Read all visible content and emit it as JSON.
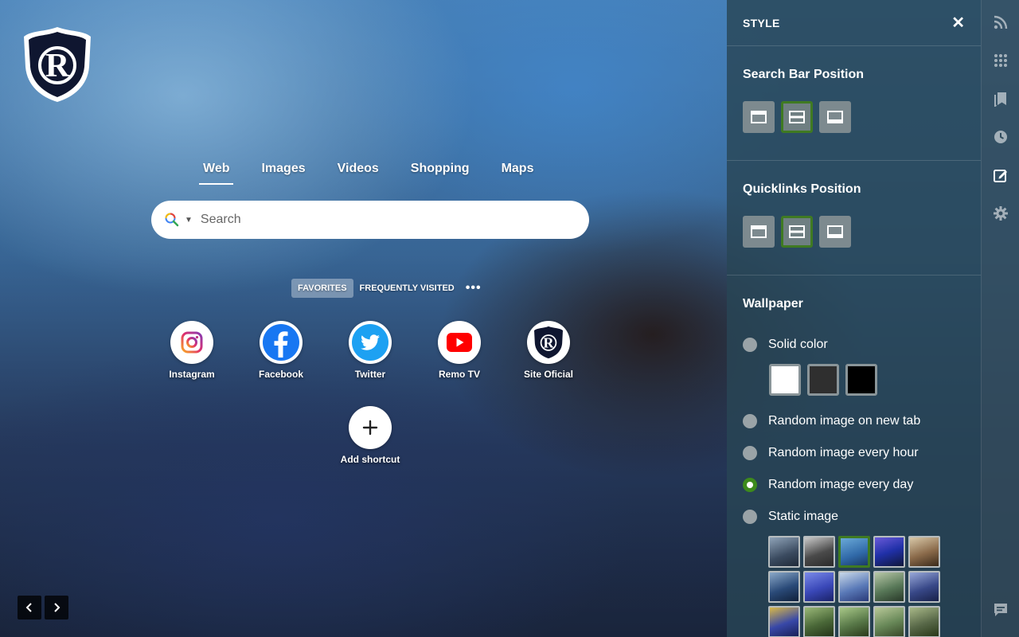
{
  "search": {
    "tabs": [
      {
        "label": "Web"
      },
      {
        "label": "Images"
      },
      {
        "label": "Videos"
      },
      {
        "label": "Shopping"
      },
      {
        "label": "Maps"
      }
    ],
    "placeholder": "Search"
  },
  "quicklinks": {
    "favorites_label": "FAVORITES",
    "frequent_label": "FREQUENTLY VISITED",
    "more_label": "•••",
    "items": [
      {
        "label": "Instagram",
        "icon": "instagram-icon"
      },
      {
        "label": "Facebook",
        "icon": "facebook-icon"
      },
      {
        "label": "Twitter",
        "icon": "twitter-icon"
      },
      {
        "label": "Remo TV",
        "icon": "youtube-icon"
      },
      {
        "label": "Site Oficial",
        "icon": "club-crest-icon"
      }
    ],
    "add_label": "Add shortcut"
  },
  "panel": {
    "title": "STYLE",
    "search_bar_position": "Search Bar Position",
    "quicklinks_position": "Quicklinks Position",
    "wallpaper": "Wallpaper",
    "options": {
      "solid": "Solid color",
      "random_new_tab": "Random image on new tab",
      "random_hour": "Random image every hour",
      "random_day": "Random image every day",
      "static": "Static image"
    },
    "selected_option": "random_day",
    "swatch_colors": [
      "#ffffff",
      "#2f2f2f",
      "#000000"
    ],
    "accent_color": "#3f7a22"
  },
  "sidebar": {
    "icons": [
      "rss-icon",
      "apps-grid-icon",
      "bookmarks-icon",
      "history-icon",
      "style-edit-icon",
      "settings-gear-icon",
      "feedback-icon"
    ]
  }
}
